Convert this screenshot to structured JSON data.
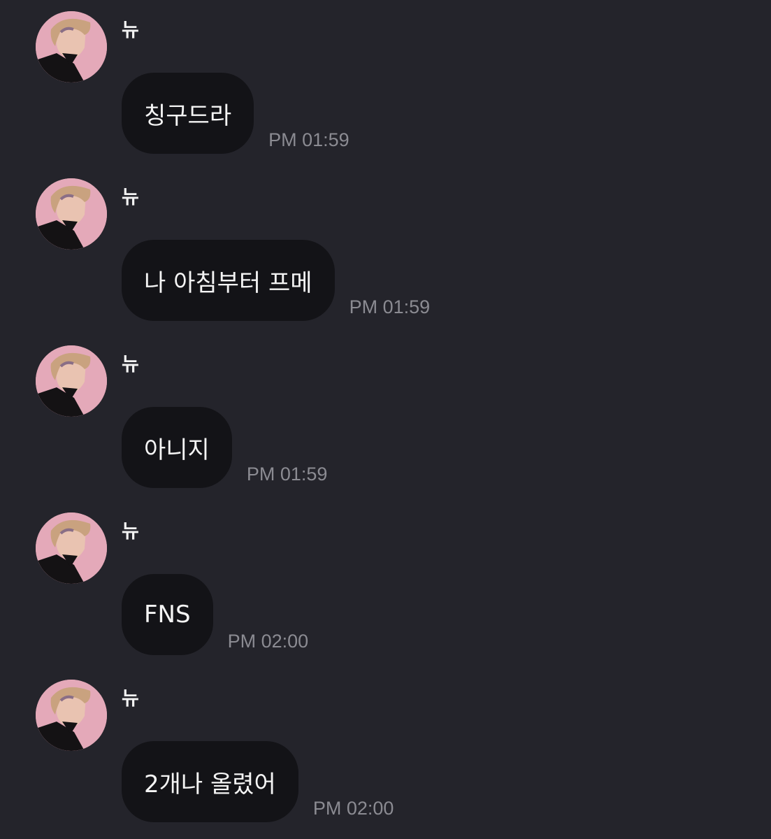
{
  "messages": [
    {
      "sender": "뉴",
      "text": "칭구드라",
      "time": "PM 01:59"
    },
    {
      "sender": "뉴",
      "text": "나 아침부터 프메",
      "time": "PM 01:59"
    },
    {
      "sender": "뉴",
      "text": "아니지",
      "time": "PM 01:59"
    },
    {
      "sender": "뉴",
      "text": "FNS",
      "time": "PM 02:00"
    },
    {
      "sender": "뉴",
      "text": "2개나 올렸어",
      "time": "PM 02:00"
    }
  ],
  "theme": {
    "background": "#24242b",
    "bubble": "#131317",
    "text": "#f4f4f4",
    "timestamp": "#8b8b92",
    "avatar_bg": "#e4a9b9"
  },
  "icons": {
    "avatar": "profile-photo"
  }
}
